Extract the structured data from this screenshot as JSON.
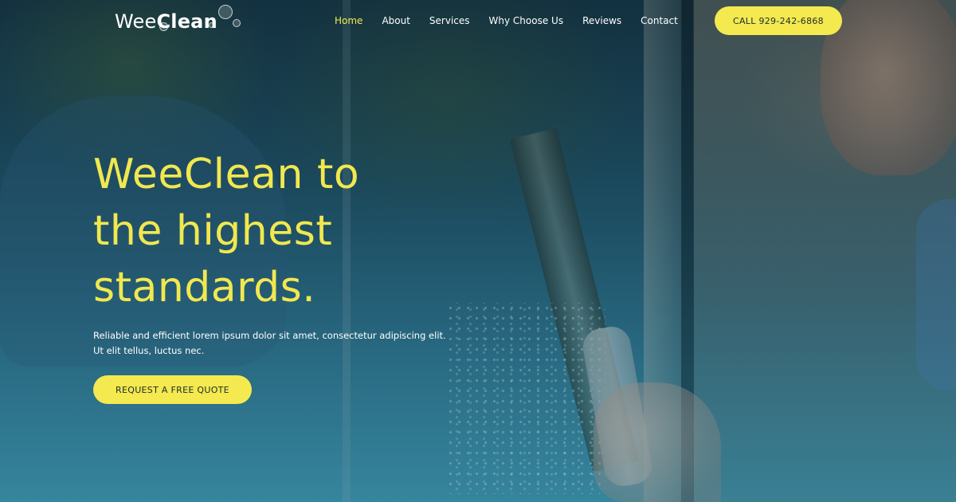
{
  "brand": {
    "logo_part1": "Wee",
    "logo_part2": "Clean"
  },
  "nav": {
    "items": [
      {
        "label": "Home",
        "active": true
      },
      {
        "label": "About",
        "active": false
      },
      {
        "label": "Services",
        "active": false
      },
      {
        "label": "Why Choose Us",
        "active": false
      },
      {
        "label": "Reviews",
        "active": false
      },
      {
        "label": "Contact",
        "active": false
      }
    ],
    "call_label": "CALL 929-242-6868"
  },
  "hero": {
    "title_lines": [
      "WeeClean to",
      "the highest",
      "standards."
    ],
    "subtitle_lines": [
      "Reliable and efficient lorem ipsum dolor sit amet, consectetur adipiscing elit.",
      "Ut elit tellus, luctus nec."
    ],
    "cta_label": "REQUEST A FREE QUOTE",
    "background_image": "man-cleaning-window-with-squeegee"
  },
  "colors": {
    "accent": "#f4e94e",
    "title": "#f1e84f",
    "text": "#ffffff",
    "overlay": "#1f5368"
  }
}
